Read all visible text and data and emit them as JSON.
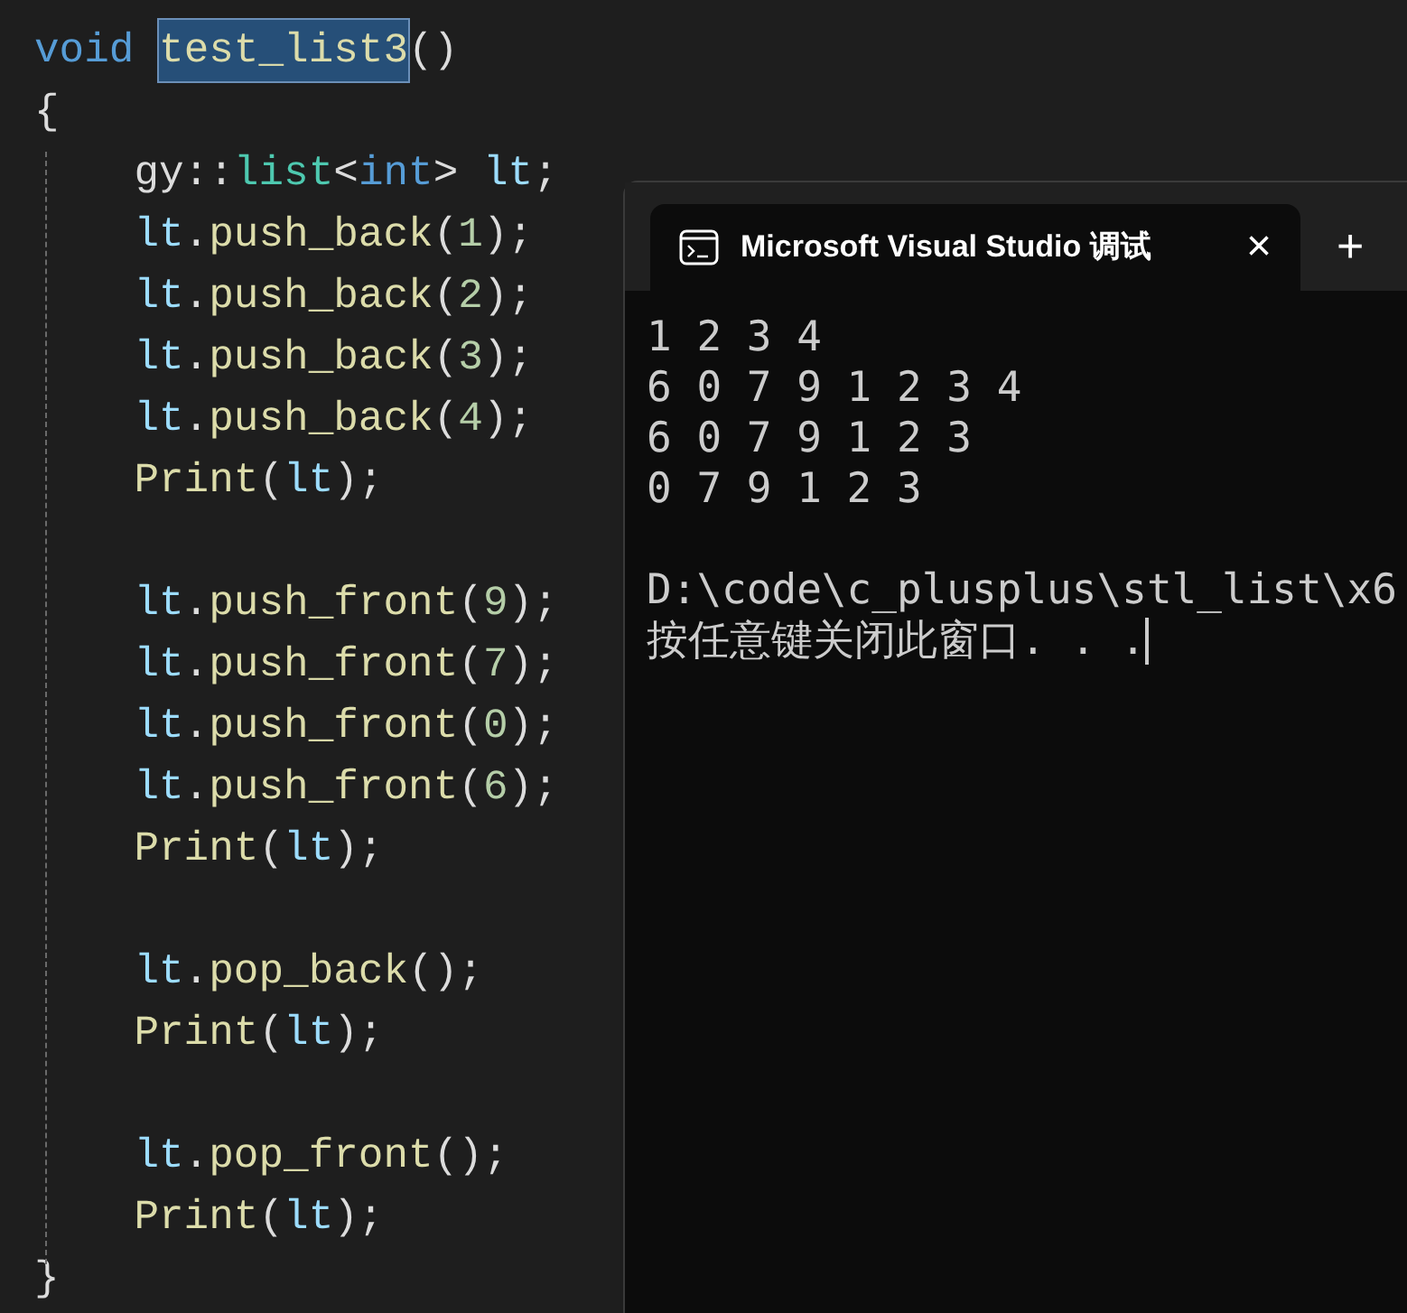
{
  "editor": {
    "lines": [
      {
        "kind": "code",
        "indented": false,
        "tokens": [
          {
            "kind": "keyword",
            "text": "void",
            "space_after": true
          },
          {
            "kind": "function",
            "text": "test_list3",
            "selected": true
          },
          {
            "kind": "punct",
            "text": "()"
          }
        ]
      },
      {
        "kind": "code",
        "indented": false,
        "tokens": [
          {
            "kind": "punct",
            "text": "{"
          }
        ]
      },
      {
        "kind": "code",
        "indented": true,
        "tokens": [
          {
            "kind": "plain",
            "text": "gy::"
          },
          {
            "kind": "type",
            "text": "list"
          },
          {
            "kind": "punct",
            "text": "<"
          },
          {
            "kind": "keyword",
            "text": "int"
          },
          {
            "kind": "punct",
            "text": ">",
            "space_after": true
          },
          {
            "kind": "variable",
            "text": "lt"
          },
          {
            "kind": "punct",
            "text": ";"
          }
        ]
      },
      {
        "kind": "code",
        "indented": true,
        "tokens": [
          {
            "kind": "variable",
            "text": "lt"
          },
          {
            "kind": "punct",
            "text": "."
          },
          {
            "kind": "function",
            "text": "push_back"
          },
          {
            "kind": "punct",
            "text": "("
          },
          {
            "kind": "number",
            "text": "1"
          },
          {
            "kind": "punct",
            "text": ");"
          }
        ]
      },
      {
        "kind": "code",
        "indented": true,
        "tokens": [
          {
            "kind": "variable",
            "text": "lt"
          },
          {
            "kind": "punct",
            "text": "."
          },
          {
            "kind": "function",
            "text": "push_back"
          },
          {
            "kind": "punct",
            "text": "("
          },
          {
            "kind": "number",
            "text": "2"
          },
          {
            "kind": "punct",
            "text": ");"
          }
        ]
      },
      {
        "kind": "code",
        "indented": true,
        "tokens": [
          {
            "kind": "variable",
            "text": "lt"
          },
          {
            "kind": "punct",
            "text": "."
          },
          {
            "kind": "function",
            "text": "push_back"
          },
          {
            "kind": "punct",
            "text": "("
          },
          {
            "kind": "number",
            "text": "3"
          },
          {
            "kind": "punct",
            "text": ");"
          }
        ]
      },
      {
        "kind": "code",
        "indented": true,
        "tokens": [
          {
            "kind": "variable",
            "text": "lt"
          },
          {
            "kind": "punct",
            "text": "."
          },
          {
            "kind": "function",
            "text": "push_back"
          },
          {
            "kind": "punct",
            "text": "("
          },
          {
            "kind": "number",
            "text": "4"
          },
          {
            "kind": "punct",
            "text": ");"
          }
        ]
      },
      {
        "kind": "code",
        "indented": true,
        "tokens": [
          {
            "kind": "function",
            "text": "Print"
          },
          {
            "kind": "punct",
            "text": "("
          },
          {
            "kind": "variable",
            "text": "lt"
          },
          {
            "kind": "punct",
            "text": ");"
          }
        ]
      },
      {
        "kind": "blank"
      },
      {
        "kind": "code",
        "indented": true,
        "tokens": [
          {
            "kind": "variable",
            "text": "lt"
          },
          {
            "kind": "punct",
            "text": "."
          },
          {
            "kind": "function",
            "text": "push_front"
          },
          {
            "kind": "punct",
            "text": "("
          },
          {
            "kind": "number",
            "text": "9"
          },
          {
            "kind": "punct",
            "text": ");"
          }
        ]
      },
      {
        "kind": "code",
        "indented": true,
        "tokens": [
          {
            "kind": "variable",
            "text": "lt"
          },
          {
            "kind": "punct",
            "text": "."
          },
          {
            "kind": "function",
            "text": "push_front"
          },
          {
            "kind": "punct",
            "text": "("
          },
          {
            "kind": "number",
            "text": "7"
          },
          {
            "kind": "punct",
            "text": ");"
          }
        ]
      },
      {
        "kind": "code",
        "indented": true,
        "tokens": [
          {
            "kind": "variable",
            "text": "lt"
          },
          {
            "kind": "punct",
            "text": "."
          },
          {
            "kind": "function",
            "text": "push_front"
          },
          {
            "kind": "punct",
            "text": "("
          },
          {
            "kind": "number",
            "text": "0"
          },
          {
            "kind": "punct",
            "text": ");"
          }
        ]
      },
      {
        "kind": "code",
        "indented": true,
        "tokens": [
          {
            "kind": "variable",
            "text": "lt"
          },
          {
            "kind": "punct",
            "text": "."
          },
          {
            "kind": "function",
            "text": "push_front"
          },
          {
            "kind": "punct",
            "text": "("
          },
          {
            "kind": "number",
            "text": "6"
          },
          {
            "kind": "punct",
            "text": ");"
          }
        ]
      },
      {
        "kind": "code",
        "indented": true,
        "tokens": [
          {
            "kind": "function",
            "text": "Print"
          },
          {
            "kind": "punct",
            "text": "("
          },
          {
            "kind": "variable",
            "text": "lt"
          },
          {
            "kind": "punct",
            "text": ");"
          }
        ]
      },
      {
        "kind": "blank"
      },
      {
        "kind": "code",
        "indented": true,
        "tokens": [
          {
            "kind": "variable",
            "text": "lt"
          },
          {
            "kind": "punct",
            "text": "."
          },
          {
            "kind": "function",
            "text": "pop_back"
          },
          {
            "kind": "punct",
            "text": "();"
          }
        ]
      },
      {
        "kind": "code",
        "indented": true,
        "tokens": [
          {
            "kind": "function",
            "text": "Print"
          },
          {
            "kind": "punct",
            "text": "("
          },
          {
            "kind": "variable",
            "text": "lt"
          },
          {
            "kind": "punct",
            "text": ");"
          }
        ]
      },
      {
        "kind": "blank"
      },
      {
        "kind": "code",
        "indented": true,
        "tokens": [
          {
            "kind": "variable",
            "text": "lt"
          },
          {
            "kind": "punct",
            "text": "."
          },
          {
            "kind": "function",
            "text": "pop_front"
          },
          {
            "kind": "punct",
            "text": "();"
          }
        ]
      },
      {
        "kind": "code",
        "indented": true,
        "tokens": [
          {
            "kind": "function",
            "text": "Print"
          },
          {
            "kind": "punct",
            "text": "("
          },
          {
            "kind": "variable",
            "text": "lt"
          },
          {
            "kind": "punct",
            "text": ");"
          }
        ]
      },
      {
        "kind": "code",
        "indented": false,
        "tokens": [
          {
            "kind": "punct",
            "text": "}"
          }
        ]
      }
    ]
  },
  "console": {
    "tab": {
      "title": "Microsoft Visual Studio 调试",
      "close": "×",
      "selected": true
    },
    "new_tab": "+",
    "output": [
      {
        "kind": "text",
        "text": "1 2 3 4"
      },
      {
        "kind": "text",
        "text": "6 0 7 9 1 2 3 4"
      },
      {
        "kind": "text",
        "text": "6 0 7 9 1 2 3"
      },
      {
        "kind": "text",
        "text": "0 7 9 1 2 3"
      },
      {
        "kind": "blank"
      },
      {
        "kind": "text",
        "text": "D:\\code\\c_plusplus\\stl_list\\x6"
      },
      {
        "kind": "text",
        "text": "按任意键关闭此窗口. . ."
      }
    ]
  }
}
